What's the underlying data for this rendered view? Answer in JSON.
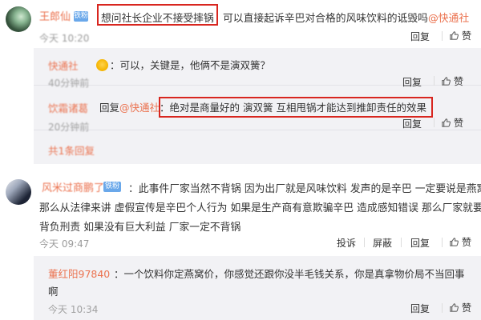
{
  "comment1": {
    "username": "王郎仙",
    "badge": "铁粉",
    "text_highlight": "想问社长企业不接受摔锅",
    "text_rest": "可以直接起诉辛巴对合格的风味饮料的诋毁吗",
    "mention": "@快通社",
    "time": "今天 10:20",
    "reply_label": "回复",
    "like_label": "赞"
  },
  "replies": [
    {
      "username": "快通社",
      "text": "：可以，关键是，他俩不是演双簧？",
      "time": "40分钟前",
      "reply_label": "回复",
      "like_label": "赞"
    },
    {
      "username": "饮霜诸葛",
      "prefix": "回复",
      "mention": "@快通社",
      "text": "：绝对是商量好的  演双簧  互相甩锅才能达到推卸责任的效果",
      "time": "20分钟前",
      "reply_label": "回复",
      "like_label": "赞"
    },
    {
      "username": "共1条回复",
      "time": "",
      "reply_label": "",
      "like_label": ""
    }
  ],
  "comment2": {
    "username": "风米过商鹏了",
    "badge": "铁粉",
    "lines": [
      "：此事件厂家当然不背锅 因为出厂就是风味饮料 发声的是辛巴 一定要说是燕窝",
      "那么从法律来讲 虚假宣传是辛巴个人行为 如果是生产商有意欺骗辛巴 造成感知错误 那么厂家就要",
      "背负刑责 如果没有巨大利益 厂家一定不背锅"
    ],
    "time": "今天 09:47",
    "report_label": "投诉",
    "block_label": "屏蔽",
    "reply_label": "回复",
    "like_label": "赞"
  },
  "reply2": {
    "username": "董红阳97840",
    "line1": "：一个饮料你定燕窝价，你感觉还跟你没半毛钱关系，你是真拿物价局不当回事",
    "line2": "啊",
    "time": "今天 10:34",
    "reply_label": "回复",
    "like_label": "赞"
  },
  "colors": {
    "accent": "#eb7350",
    "highlight_box": "#d8261f",
    "reply_bg": "#f2f2f5",
    "badge": "#6aa8ea"
  }
}
